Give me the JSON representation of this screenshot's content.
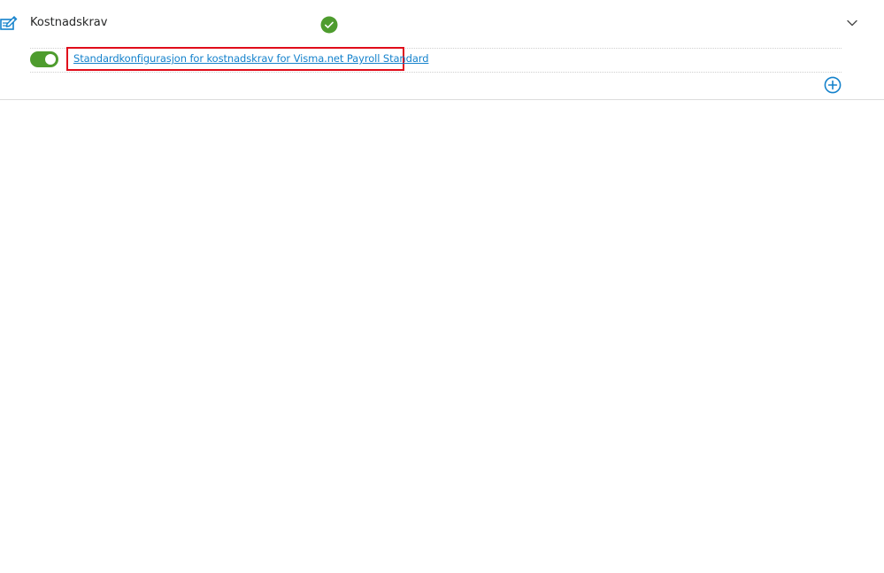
{
  "section": {
    "title": "Kostnadskrav",
    "icon": "edit-document-icon",
    "status": "check-circle-icon",
    "expand_icon": "chevron-down-icon"
  },
  "configuration": {
    "enabled": true,
    "link_text": "Standardkonfigurasjon for kostnadskrav for Visma.net Payroll Standard"
  },
  "actions": {
    "add_icon": "plus-circle-icon"
  },
  "colors": {
    "accent": "#1482cc",
    "toggle_on": "#4e9c2e",
    "status_ok": "#4e9c2e",
    "highlight": "#e00d1b"
  }
}
